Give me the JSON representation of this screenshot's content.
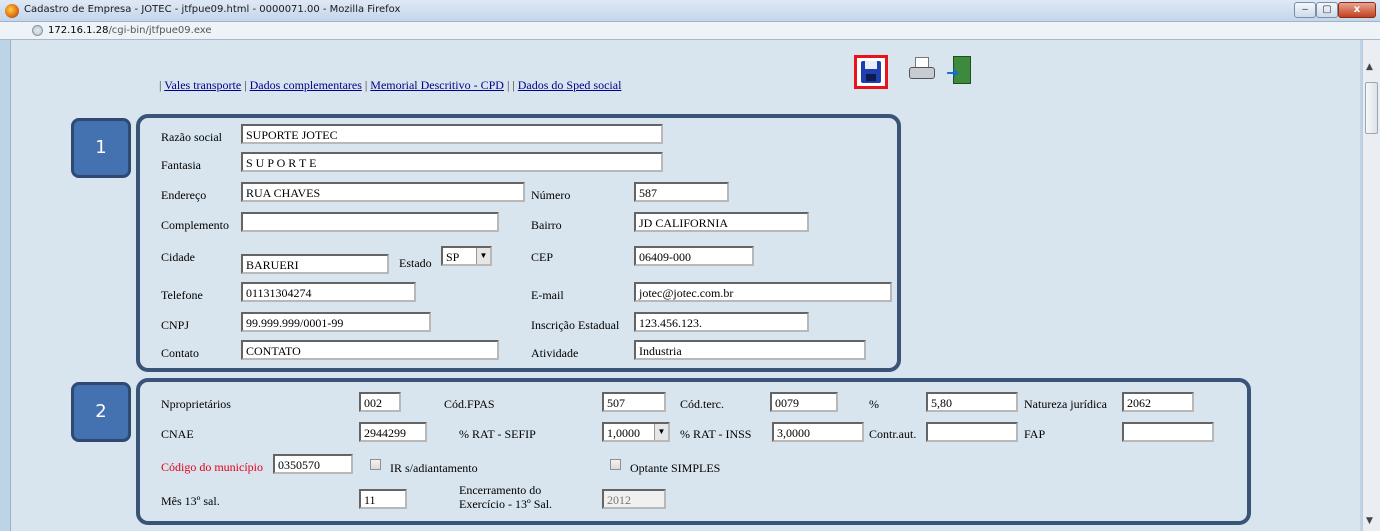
{
  "window": {
    "title": "Cadastro de Empresa - JOTEC - jtfpue09.html - 0000071.00 - Mozilla Firefox",
    "url_host": "172.16.1.28",
    "url_path": "/cgi-bin/jtfpue09.exe",
    "minimize": "‒",
    "maximize": "▢",
    "close": "x"
  },
  "nav_links": [
    "Vales transporte",
    "Dados complementares",
    "Memorial Descritivo - CPD",
    "Dados do Sped social"
  ],
  "nav_separator": "|",
  "badges": {
    "one": "1",
    "two": "2"
  },
  "section1": {
    "razao_social_label": "Razão social",
    "razao_social": "SUPORTE  JOTEC",
    "fantasia_label": "Fantasia",
    "fantasia": "S U P O R T E",
    "endereco_label": "Endereço",
    "endereco": "RUA CHAVES",
    "numero_label": "Número",
    "numero": "587",
    "complemento_label": "Complemento",
    "complemento": "",
    "bairro_label": "Bairro",
    "bairro": "JD CALIFORNIA",
    "cidade_label": "Cidade",
    "cidade": "BARUERI",
    "estado_label": "Estado",
    "estado": "SP",
    "cep_label": "CEP",
    "cep": "06409-000",
    "telefone_label": "Telefone",
    "telefone": "01131304274",
    "email_label": "E-mail",
    "email": "jotec@jotec.com.br",
    "cnpj_label": "CNPJ",
    "cnpj": "99.999.999/0001-99",
    "ie_label": "Inscrição Estadual",
    "ie": "123.456.123.",
    "contato_label": "Contato",
    "contato": "CONTATO",
    "atividade_label": "Atividade",
    "atividade": "Industria"
  },
  "section2": {
    "nproprietarios_label": "Nproprietários",
    "nproprietarios": "002",
    "cod_fpas_label": "Cód.FPAS",
    "cod_fpas": "507",
    "cod_terc_label": "Cód.terc.",
    "cod_terc": "0079",
    "percent_label": "%",
    "percent": "5,80",
    "natureza_label": "Natureza jurídica",
    "natureza": "2062",
    "cnae_label": "CNAE",
    "cnae": "2944299",
    "rat_sefip_label": "% RAT - SEFIP",
    "rat_sefip": "1,0000",
    "rat_inss_label": "% RAT - INSS",
    "rat_inss": "3,0000",
    "contr_aut_label": "Contr.aut.",
    "contr_aut": "",
    "fap_label": "FAP",
    "fap": "",
    "cod_municipio_label": "Código do município",
    "cod_municipio": "0350570",
    "ir_label": "IR s/adiantamento",
    "simples_label": "Optante SIMPLES",
    "mes13_label": "Mês 13º sal.",
    "mes13": "11",
    "encerramento_label_1": "Encerramento do",
    "encerramento_label_2": "Exercício - 13º Sal.",
    "encerramento": "2012"
  },
  "colors": {
    "accent_red": "#e8141c",
    "panel_border": "#3a5478",
    "badge": "#4472b0",
    "page_bg": "#d9e5ee"
  },
  "icons": [
    "firefox-icon",
    "globe-icon",
    "save-icon",
    "print-icon",
    "exit-icon"
  ]
}
